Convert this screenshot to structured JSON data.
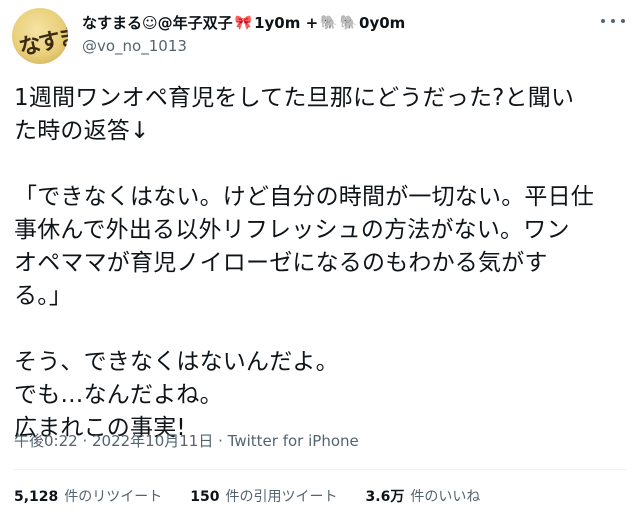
{
  "user": {
    "avatar_text": "なすまる",
    "name": "なすまる☺@年子双子",
    "name_suffix_1": "1y0m +",
    "name_suffix_2": "0y0m",
    "handle": "@vo_no_1013"
  },
  "icons": {
    "ribbon": "🎀",
    "elephant": "🐘",
    "more": "more-icon"
  },
  "tweet": {
    "para1": "1週間ワンオペ育児をしてた旦那にどうだった?と聞い\nた時の返答↓",
    "para2": "「できなくはない。けど自分の時間が一切ない。平日仕\n事休んで外出る以外リフレッシュの方法がない。ワン\nオペママが育児ノイローゼになるのもわかる気がす\nる。」",
    "para3": "そう、できなくはないんだよ。\nでも…なんだよね。\n広まれこの事実!"
  },
  "meta": {
    "time": "午後0:22",
    "sep1": " · ",
    "date": "2022年10月11日",
    "sep2": " · ",
    "source": "Twitter for iPhone"
  },
  "stats": {
    "retweets_num": "5,128",
    "retweets_label": "件のリツイート",
    "quotes_num": "150",
    "quotes_label": "件の引用ツイート",
    "likes_num": "3.6万",
    "likes_label": "件のいいね"
  }
}
